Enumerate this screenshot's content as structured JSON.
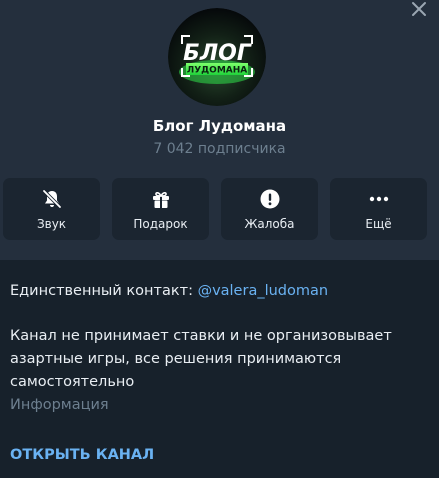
{
  "channel": {
    "name": "Блог Лудомана",
    "subscribers": "7 042 подписчика",
    "avatar_text_line1": "БЛОГ",
    "avatar_text_line2": "ЛУДОМАНА"
  },
  "actions": [
    {
      "label": "Звук",
      "icon": "bell-slash-icon"
    },
    {
      "label": "Подарок",
      "icon": "gift-icon"
    },
    {
      "label": "Жалоба",
      "icon": "exclamation-icon"
    },
    {
      "label": "Ещё",
      "icon": "more-dots-icon"
    }
  ],
  "info": {
    "contact_prefix": "Единственный контакт: ",
    "contact_link": "@valera_ludoman",
    "description": "Канал не принимает ставки и не организовывает азартные игры, все решения принимаются самостоятельно",
    "label": "Информация"
  },
  "open_channel_label": "ОТКРЫТЬ КАНАЛ",
  "colors": {
    "background": "#17212b",
    "header": "#242f3d",
    "card": "#1b2530",
    "accent": "#6ab2f2",
    "muted": "#6d7f8f",
    "avatar_green": "#3df24a"
  }
}
